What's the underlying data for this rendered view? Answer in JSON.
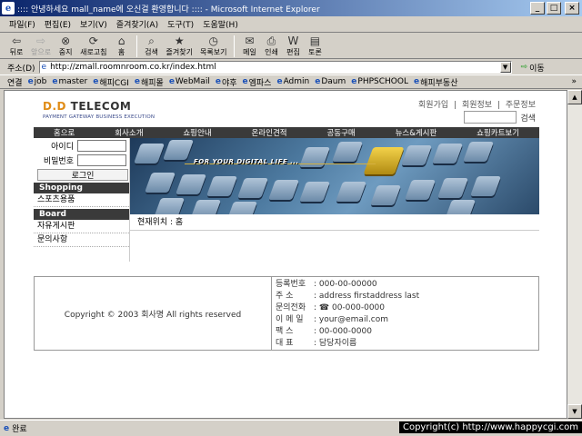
{
  "window": {
    "title": ":::: 안녕하세요 mall_name에 오신걸 환영합니다 :::: - Microsoft Internet Explorer",
    "min": "_",
    "max": "□",
    "close": "×"
  },
  "menu": [
    "파일(F)",
    "편집(E)",
    "보기(V)",
    "즐겨찾기(A)",
    "도구(T)",
    "도움말(H)"
  ],
  "toolbar": {
    "back": "뒤로",
    "forward": "앞으로",
    "stop": "중지",
    "refresh": "새로고침",
    "home": "홈",
    "search": "검색",
    "favorites": "즐겨찾기",
    "history": "목록보기",
    "mail": "메일",
    "print": "인쇄",
    "edit": "편집",
    "discuss": "토론"
  },
  "address": {
    "label": "주소(D)",
    "url": "http://zmall.roomnroom.co.kr/index.html",
    "go": "이동"
  },
  "links": {
    "label": "연결",
    "items": [
      "job",
      "master",
      "해피CGI",
      "해피몰",
      "WebMail",
      "야후",
      "엠파스",
      "Admin",
      "Daum",
      "PHPSCHOOL",
      "해피부동산"
    ],
    "more": "»"
  },
  "site": {
    "logo_dd": "D.D",
    "logo_tel": "TELECOM",
    "tagline": "PAYMENT GATEWAY BUSINESS EXECUTION",
    "toplinks": [
      "회원가입",
      "|",
      "회원정보",
      "|",
      "주문정보"
    ],
    "search_btn": "검색",
    "nav": [
      "홈으로",
      "회사소개",
      "쇼핑안내",
      "온라인견적",
      "공동구매",
      "뉴스&게시판",
      "쇼핑카트보기"
    ],
    "login_id": "아이디",
    "login_pw": "비밀번호",
    "login_btn": "로그인",
    "cat_shopping": "Shopping",
    "item_sports": "스포츠용품",
    "cat_board": "Board",
    "item_free": "자유게시판",
    "item_qna": "문의사항",
    "banner_text": "FOR YOUR DIGITAL LIFE ...",
    "curpos": "현재위치 : 홈",
    "copyright": "Copyright © 2003 회사명 All rights reserved",
    "info": [
      {
        "k": "등록번호",
        "v": ": 000-00-00000"
      },
      {
        "k": "주    소",
        "v": ": address firstaddress last"
      },
      {
        "k": "문의전화",
        "v": ": ☎ 00-000-0000"
      },
      {
        "k": "이 메 일",
        "v": ": your@email.com"
      },
      {
        "k": "팩    스",
        "v": ": 00-000-0000"
      },
      {
        "k": "대    표",
        "v": ": 담당자이름"
      }
    ]
  },
  "status": {
    "text": "완료"
  },
  "overlay": "Copyright(c) http://www.happycgi.com"
}
